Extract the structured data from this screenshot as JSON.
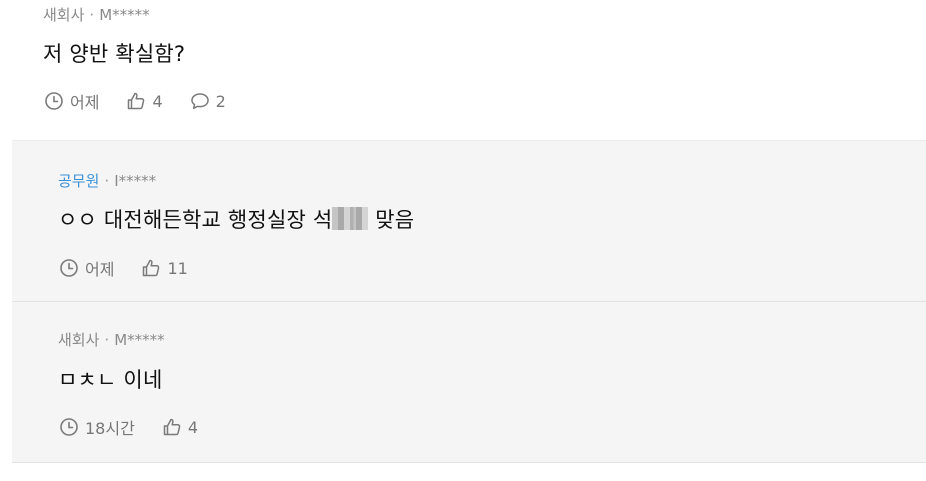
{
  "comments": [
    {
      "company": "새회사",
      "separator": "·",
      "author": "M*****",
      "text": "저 양반 확실함?",
      "time": "어제",
      "likes": "4",
      "replies": "2"
    },
    {
      "company": "공무원",
      "separator": "·",
      "author": "I*****",
      "text_before": "ㅇㅇ 대전해든학교 행정실장 석",
      "text_after": " 맞음",
      "time": "어제",
      "likes": "11"
    },
    {
      "company": "새회사",
      "separator": "·",
      "author": "M*****",
      "text": "ㅁㅊㄴ 이네",
      "time": "18시간",
      "likes": "4"
    }
  ],
  "colors": {
    "company_highlight": "#3a91d6",
    "reply_background": "#f5f5f5",
    "meta_text": "#8a8a8a"
  }
}
